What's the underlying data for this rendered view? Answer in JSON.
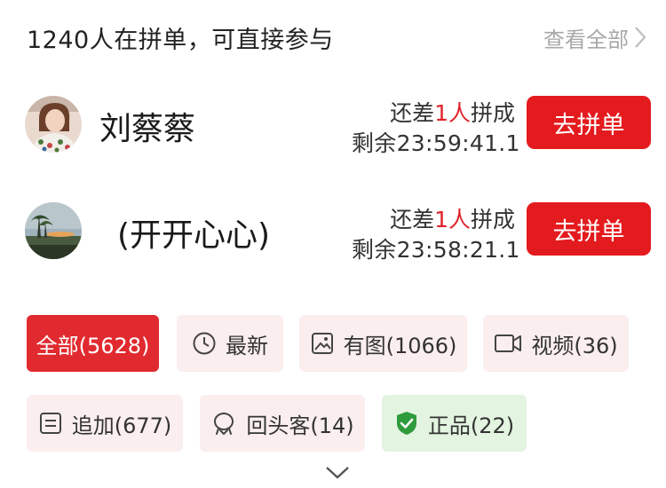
{
  "header": {
    "title": "1240人在拼单，可直接参与",
    "view_all": "查看全部"
  },
  "groups": [
    {
      "name": "刘蔡蔡",
      "need_prefix": "还差",
      "need_count": "1人",
      "need_suffix": "拼成",
      "timer": "剩余23:59:41.1",
      "button": "去拼单"
    },
    {
      "name": "(开开心心)",
      "need_prefix": "还差",
      "need_count": "1人",
      "need_suffix": "拼成",
      "timer": "剩余23:58:21.1",
      "button": "去拼单"
    }
  ],
  "filters": [
    {
      "label": "全部(5628)",
      "icon": "none",
      "state": "active"
    },
    {
      "label": "最新",
      "icon": "clock-icon"
    },
    {
      "label": "有图(1066)",
      "icon": "image-icon"
    },
    {
      "label": "视频(36)",
      "icon": "video-icon"
    },
    {
      "label": "追加(677)",
      "icon": "note-icon"
    },
    {
      "label": "回头客(14)",
      "icon": "repeat-customer-icon"
    },
    {
      "label": "正品(22)",
      "icon": "shield-check-icon",
      "state": "green"
    }
  ],
  "colors": {
    "accent": "#e41b1e",
    "chip_background": "#fbeeee",
    "genuine_chip_background": "#e3f4e1",
    "genuine_icon": "#2e9b3c"
  }
}
